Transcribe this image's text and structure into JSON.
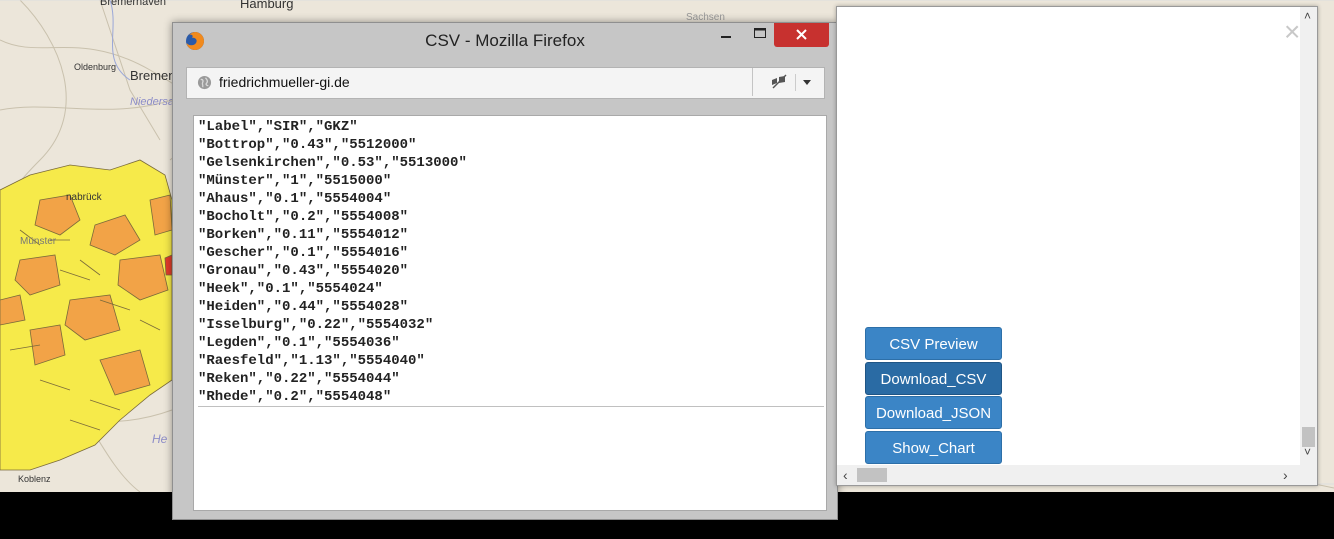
{
  "map": {
    "labels": {
      "bremerhaven": "Bremerhaven",
      "hamburg": "Hamburg",
      "oldenburg": "Oldenburg",
      "bremen": "Bremen",
      "niedersachsen": "Niedersa",
      "osnabrueck": "nabrück",
      "muenster": "Münster",
      "hessen": "He",
      "koblenz": "Koblenz",
      "sachsen": "Sachsen"
    },
    "colors": {
      "yellow": "#f6ea4a",
      "orange": "#f2a347",
      "red": "#e23b2b"
    }
  },
  "firefox": {
    "title": "CSV - Mozilla Firefox",
    "url": "friedrichmueller-gi.de",
    "close_symbol": "✕",
    "csv_lines": [
      "\"Label\",\"SIR\",\"GKZ\"",
      "\"Bottrop\",\"0.43\",\"5512000\"",
      "\"Gelsenkirchen\",\"0.53\",\"5513000\"",
      "\"Münster\",\"1\",\"5515000\"",
      "\"Ahaus\",\"0.1\",\"5554004\"",
      "\"Bocholt\",\"0.2\",\"5554008\"",
      "\"Borken\",\"0.11\",\"5554012\"",
      "\"Gescher\",\"0.1\",\"5554016\"",
      "\"Gronau\",\"0.43\",\"5554020\"",
      "\"Heek\",\"0.1\",\"5554024\"",
      "\"Heiden\",\"0.44\",\"5554028\"",
      "\"Isselburg\",\"0.22\",\"5554032\"",
      "\"Legden\",\"0.1\",\"5554036\"",
      "\"Raesfeld\",\"1.13\",\"5554040\"",
      "\"Reken\",\"0.22\",\"5554044\"",
      "\"Rhede\",\"0.2\",\"5554048\""
    ]
  },
  "panel": {
    "close_symbol": "×",
    "buttons": {
      "csv_preview": "CSV Preview",
      "download_csv": "Download_CSV",
      "download_json": "Download_JSON",
      "show_chart": "Show_Chart"
    },
    "accent": "#3b85c6"
  }
}
